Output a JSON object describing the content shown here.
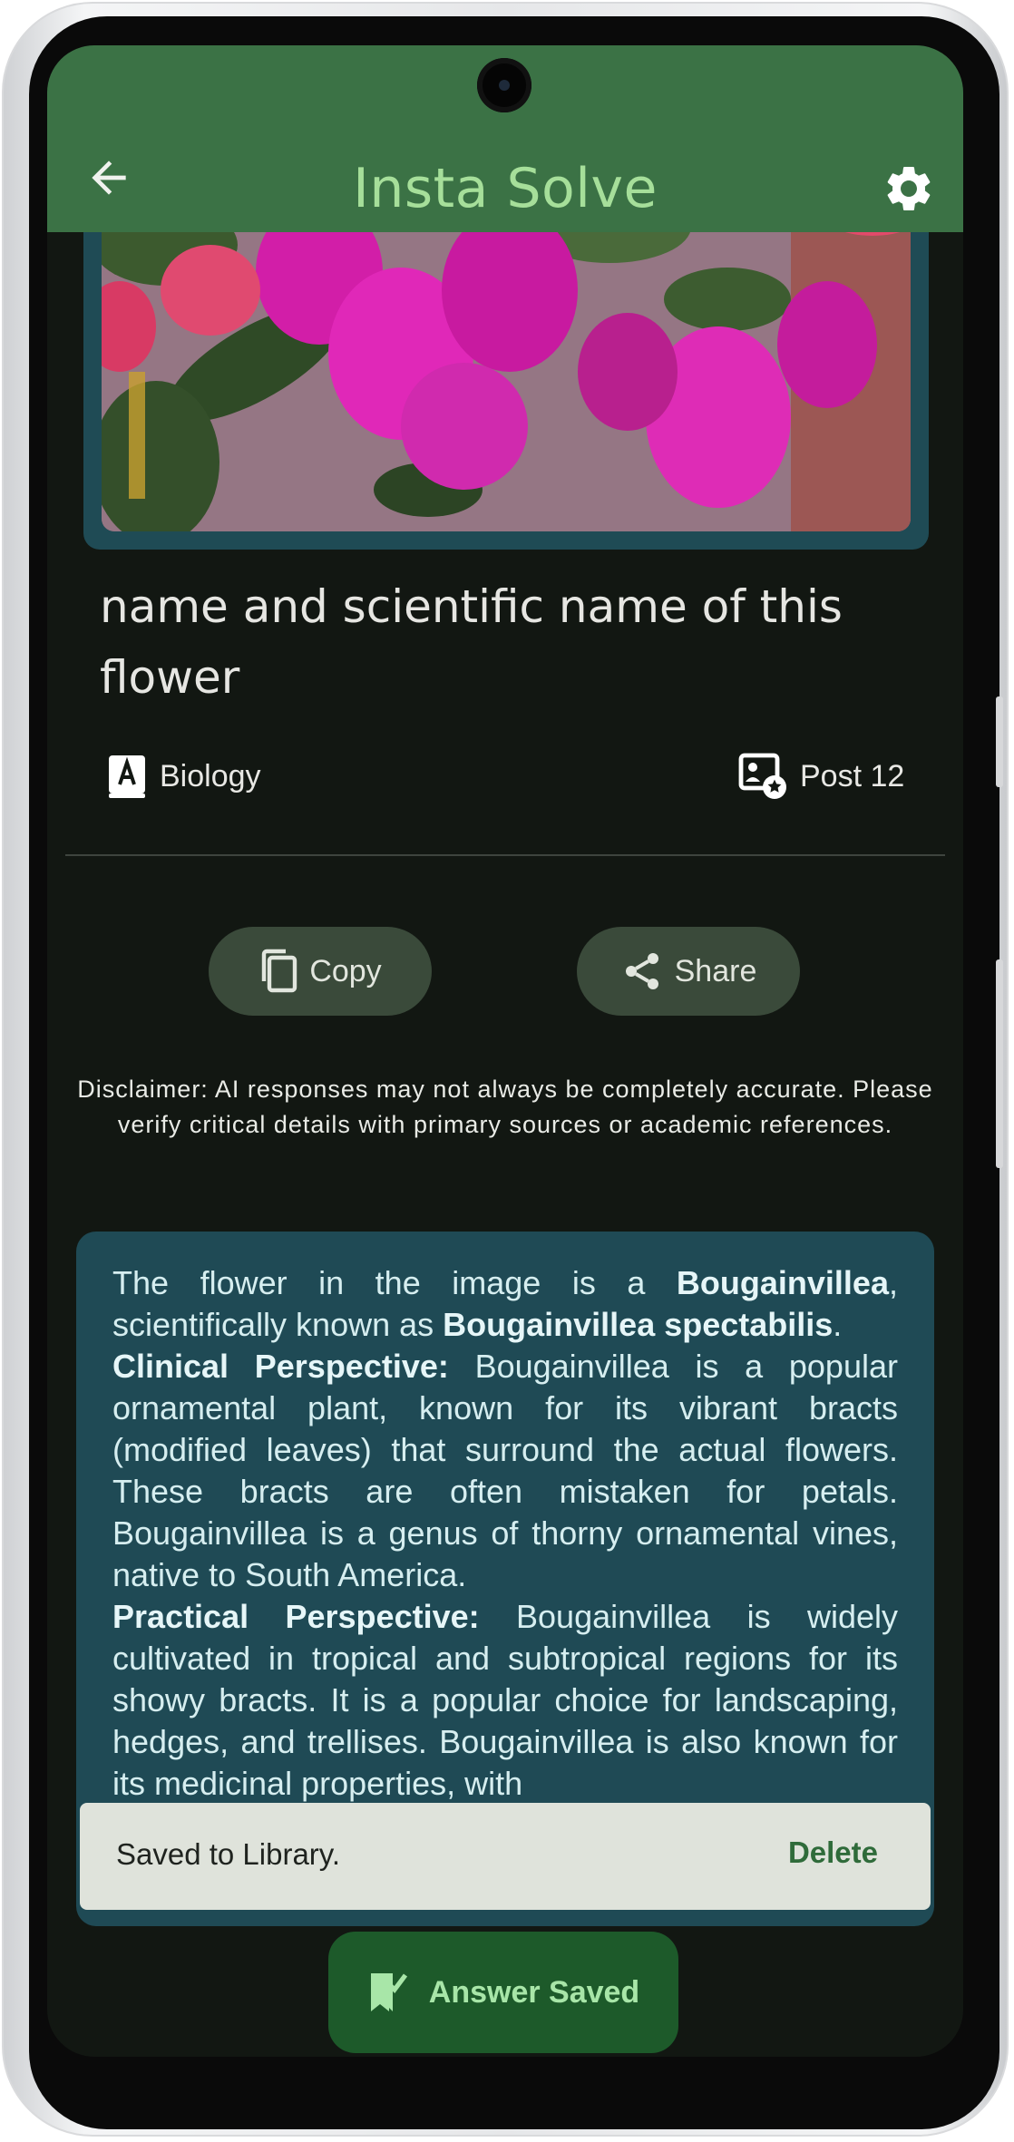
{
  "app": {
    "title": "Insta Solve",
    "back_icon": "arrow-left-icon",
    "settings_icon": "gear-icon"
  },
  "question": {
    "text": "name and scientific name of this flower",
    "subject_icon": "book-a-icon",
    "subject": "Biology",
    "post_icon": "post-badge-icon",
    "post": "Post 12"
  },
  "actions": {
    "copy_label": "Copy",
    "copy_icon": "copy-icon",
    "share_label": "Share",
    "share_icon": "share-icon"
  },
  "disclaimer": "Disclaimer: AI responses may not always be completely accurate. Please verify critical details with primary sources or academic references.",
  "answer": {
    "p1_a": "The flower in the image is a ",
    "p1_b": "Bougainvillea",
    "p1_c": ", scientifically known as ",
    "p1_d": "Bougainvillea spectabilis",
    "p1_e": ".",
    "p2_title": "Clinical Perspective:",
    "p2_text": " Bougainvillea is a popular ornamental plant, known for its vibrant bracts (modified leaves) that surround the actual flowers. These bracts are often mistaken for petals. Bougainvillea is a genus of thorny ornamental vines, native to South America.",
    "p3_title": "Practical Perspective:",
    "p3_text": " Bougainvillea is widely cultivated in tropical and subtropical regions for its showy bracts. It is a popular choice for landscaping, hedges, and trellises. Bougainvillea is also known for its medicinal properties, with"
  },
  "snackbar": {
    "message": "Saved to Library.",
    "action": "Delete"
  },
  "fab": {
    "label": "Answer Saved",
    "icon": "bookmark-check-icon"
  },
  "colors": {
    "app_bar": "#3b7245",
    "title": "#a6df9a",
    "background": "#121712",
    "answer_card": "#1f4a55",
    "fab": "#1d5a2a",
    "snackbar": "#dfe3db"
  }
}
